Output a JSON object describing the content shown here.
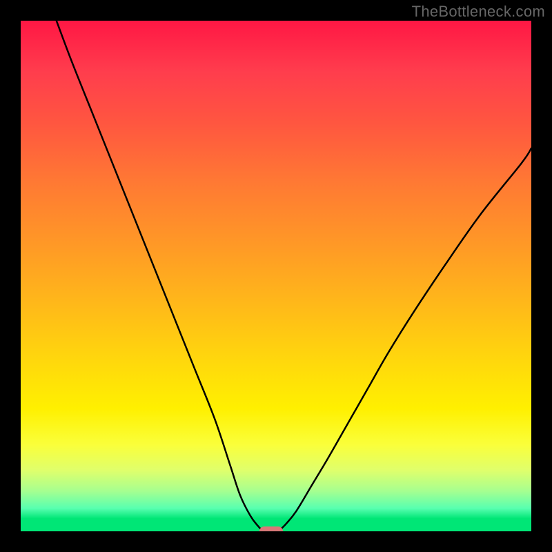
{
  "watermark": "TheBottleneck.com",
  "chart_data": {
    "type": "line",
    "title": "",
    "xlabel": "",
    "ylabel": "",
    "xlim": [
      0,
      100
    ],
    "ylim": [
      0,
      100
    ],
    "series": [
      {
        "name": "curve-left",
        "x": [
          7,
          10,
          14,
          18,
          22,
          26,
          30,
          34,
          38,
          41,
          43,
          45,
          46.5,
          47.5
        ],
        "values": [
          100,
          92,
          82,
          72,
          62,
          52,
          42,
          32,
          22,
          13,
          7,
          3,
          1,
          0
        ]
      },
      {
        "name": "curve-right",
        "x": [
          50.5,
          52,
          54,
          57,
          60,
          64,
          68,
          72,
          77,
          83,
          90,
          98,
          100
        ],
        "values": [
          0,
          1.5,
          4,
          9,
          14,
          21,
          28,
          35,
          43,
          52,
          62,
          72,
          75
        ]
      }
    ],
    "marker": {
      "x": 49,
      "y": 0
    },
    "background": {
      "type": "vertical-gradient",
      "stops": [
        {
          "pos": 0,
          "color": "#ff1744"
        },
        {
          "pos": 0.55,
          "color": "#ffb71a"
        },
        {
          "pos": 0.76,
          "color": "#fff000"
        },
        {
          "pos": 0.97,
          "color": "#00e676"
        },
        {
          "pos": 1.0,
          "color": "#00e676"
        }
      ]
    }
  }
}
